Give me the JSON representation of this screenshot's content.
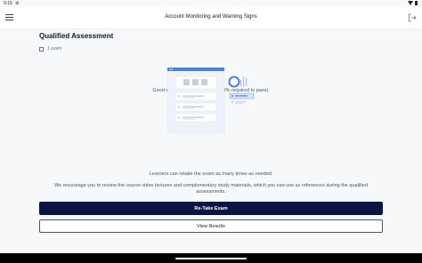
{
  "statusbar": {
    "time": "9:16"
  },
  "appbar": {
    "title": "Account Monitoring and Warning Signs",
    "menu_icon": "hamburger-menu-icon",
    "logout_icon": "logout-icon"
  },
  "assessment": {
    "title": "Qualified Assessment",
    "meta": "1 exam",
    "score_text": "Good effort! You score is 21% (80% required to pass).",
    "retake_note": "Learners can retake the exam as many times as needed.",
    "encourage_text": "We encourage you to review the course video lectures and complementary study materials, which you can use as references during the qualified assessments.",
    "retake_button": "Re-Take Exam",
    "results_button": "View Results"
  },
  "colors": {
    "primary_button": "#0b1340",
    "illustration_accent": "#4f7fd8"
  }
}
